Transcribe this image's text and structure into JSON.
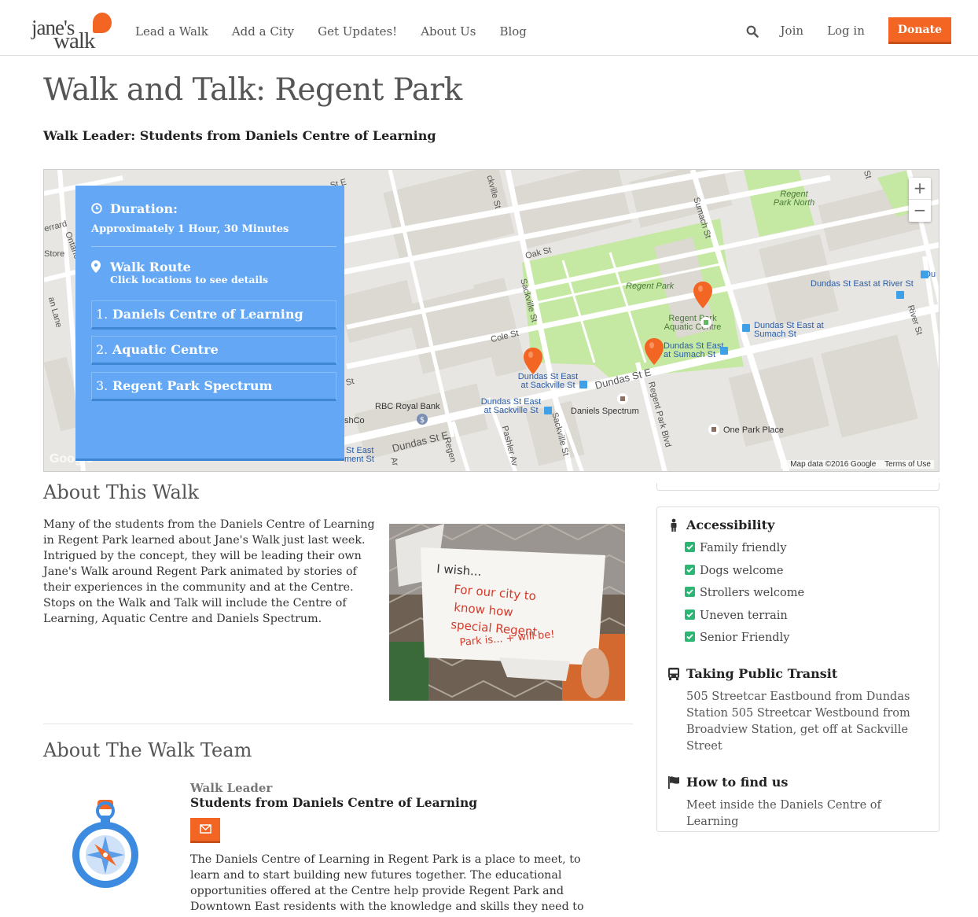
{
  "header": {
    "logo_line1": "jane's",
    "logo_line2": "walk",
    "nav": [
      "Lead a Walk",
      "Add a City",
      "Get Updates!",
      "About Us",
      "Blog"
    ],
    "join": "Join",
    "login": "Log in",
    "donate": "Donate"
  },
  "page": {
    "title": "Walk and Talk: Regent Park",
    "leader_line": "Walk Leader: Students from Daniels Centre of Learning"
  },
  "map": {
    "panel": {
      "duration_title": "Duration:",
      "duration_value": "Approximately 1 Hour, 30 Minutes",
      "route_title": "Walk Route",
      "route_subtitle": "Click locations to see details",
      "stops": [
        {
          "num": "1.",
          "name": "Daniels Centre of Learning"
        },
        {
          "num": "2.",
          "name": "Aquatic Centre"
        },
        {
          "num": "3.",
          "name": "Regent Park Spectrum"
        }
      ]
    },
    "zoom_in": "+",
    "zoom_out": "−",
    "google": "Google",
    "map_data": "Map data ©2016 Google",
    "terms": "Terms of Use",
    "labels": {
      "oak": "Oak St",
      "cole": "Cole St",
      "sackville1": "Sackville St",
      "sackville2": "Sackville St",
      "sumach": "Sumach St",
      "river": "River St",
      "dundas1": "Dundas St E",
      "dundas2": "Dundas St E",
      "rpblvd": "Regent Park Blvd",
      "pashler": "Pashler Av",
      "regent_park": "Regent Park",
      "regent_park_north": "Regent Park North",
      "aquatic": "Regent Park Aquatic Centre",
      "stop_sumach": "Dundas St East at Sumach St",
      "stop_sumach2": "Dundas St East at Sumach St",
      "stop_river": "Dundas St East at River St",
      "stop_sackville1": "Dundas St East at Sackville St",
      "stop_sackville2": "Dundas St East at Sackville St",
      "rbc": "RBC Royal Bank",
      "spectrum": "Daniels Spectrum",
      "one_park": "One Park Place",
      "store": "Store",
      "ontario": "Ontario",
      "gerrard": "errard",
      "lane": "an Lane",
      "shco": "shCo",
      "st_east": "St East",
      "ment": "ment St",
      "ste": "St E",
      "st": "St",
      "regen": "Regen",
      "ar": "Ar",
      "du": "Du",
      "st_top": "St",
      "ckville": "ckville St"
    }
  },
  "about": {
    "heading": "About This Walk",
    "text": "Many of the students from the Daniels Centre of Learning in Regent Park learned about Jane's Walk just last week.  Intrigued by the concept, they will be leading their own Jane's Walk around Regent Park animated by stories of their experiences in the community and at the Centre.  Stops on the Walk and Talk will include the Centre of Learning, Aquatic Centre and Daniels Spectrum.",
    "photo_text": [
      "I wish...",
      "For our city to",
      "know how",
      "special Regent",
      "Park is... + will be!"
    ]
  },
  "team": {
    "heading": "About The Walk Team",
    "role": "Walk Leader",
    "member": "Students from Daniels Centre of Learning",
    "bio": "The Daniels Centre of Learning in Regent Park is a place to meet, to learn and to start building new futures together. The educational opportunities offered at the Centre help provide Regent Park and Downtown East residents with the knowledge and skills they need to engage in personal"
  },
  "sidebar": {
    "accessibility_title": "Accessibility",
    "features": [
      "Family friendly",
      "Dogs welcome",
      "Strollers welcome",
      "Uneven terrain",
      "Senior Friendly"
    ],
    "transit_title": "Taking Public Transit",
    "transit_text": "505 Streetcar Eastbound from Dundas Station 505 Streetcar Westbound from Broadview Station, get off at Sackville Street",
    "find_title": "How to find us",
    "find_text": "Meet inside the Daniels Centre of Learning"
  },
  "colors": {
    "accent": "#f26522",
    "panel": "#64a8f5",
    "check": "#2bb673",
    "park": "#c5e8a3"
  }
}
